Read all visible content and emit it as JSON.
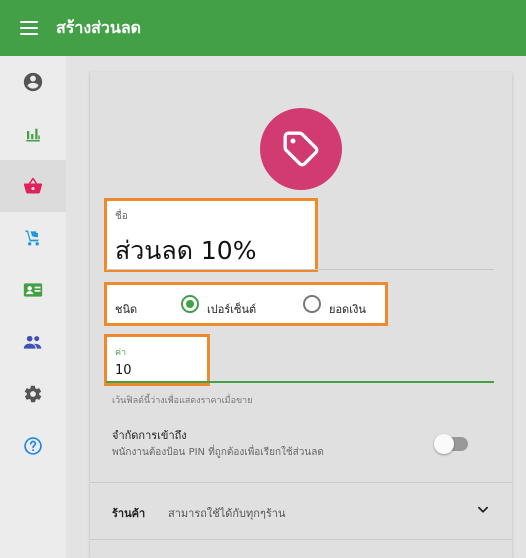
{
  "app": {
    "title": "สร้างส่วนลด",
    "accent": "#43a047",
    "highlight": "#ef8a2c",
    "avatar_color": "#d23a72"
  },
  "nav": {
    "items": [
      {
        "name": "account-icon",
        "icon": "account-circle",
        "color": "#555555",
        "active": false
      },
      {
        "name": "reports-icon",
        "icon": "bar-chart",
        "color": "#43a047",
        "active": false
      },
      {
        "name": "items-icon",
        "icon": "shopping-basket",
        "color": "#e0225c",
        "active": true
      },
      {
        "name": "inventory-icon",
        "icon": "hand-truck",
        "color": "#1e9bd7",
        "active": false
      },
      {
        "name": "customers-icon",
        "icon": "contact-card",
        "color": "#43a047",
        "active": false
      },
      {
        "name": "employees-icon",
        "icon": "people",
        "color": "#3f51b5",
        "active": false
      },
      {
        "name": "settings-icon",
        "icon": "gear",
        "color": "#555555",
        "active": false
      },
      {
        "name": "help-icon",
        "icon": "help-circle",
        "color": "#1e88e5",
        "active": false
      }
    ]
  },
  "form": {
    "avatar_icon": "tag-icon",
    "name": {
      "label": "ชื่อ",
      "value": "ส่วนลด 10%"
    },
    "type": {
      "label": "ชนิด",
      "options": [
        {
          "label": "เปอร์เซ็นต์",
          "checked": true
        },
        {
          "label": "ยอดเงิน",
          "checked": false
        }
      ]
    },
    "value": {
      "label": "ค่า",
      "value": "10",
      "helper": "เว้นฟิลด์นี้ว่างเพื่อแสดงราคาเมื่อขาย"
    },
    "restrict": {
      "title": "จำกัดการเข้าถึง",
      "subtitle": "พนักงานต้องป้อน PIN ที่ถูกต้องเพื่อเรียกใช้ส่วนลด",
      "enabled": false
    },
    "stores": {
      "label": "ร้านค้า",
      "value": "สามารถใช้ได้กับทุกๆร้าน"
    }
  }
}
